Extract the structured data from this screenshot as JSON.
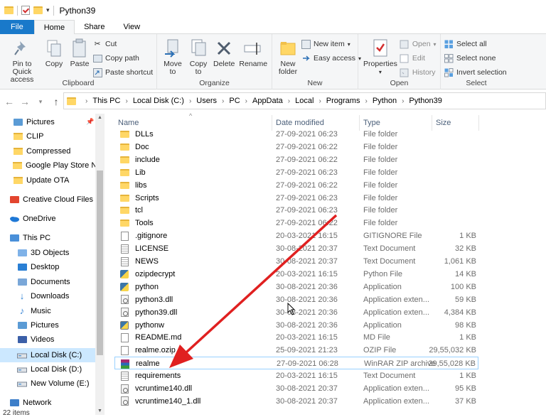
{
  "title": "Python39",
  "tabs": [
    "File",
    "Home",
    "Share",
    "View"
  ],
  "ribbon": {
    "clipboard": {
      "label": "Clipboard",
      "pin": "Pin to Quick access",
      "copy": "Copy",
      "paste": "Paste",
      "cut": "Cut",
      "copy_path": "Copy path",
      "paste_shortcut": "Paste shortcut"
    },
    "organize": {
      "label": "Organize",
      "move_to": "Move to",
      "copy_to": "Copy to",
      "delete": "Delete",
      "rename": "Rename"
    },
    "new": {
      "label": "New",
      "new_folder": "New folder",
      "new_item": "New item",
      "easy_access": "Easy access"
    },
    "open": {
      "label": "Open",
      "properties": "Properties",
      "open": "Open",
      "edit": "Edit",
      "history": "History"
    },
    "select": {
      "label": "Select",
      "select_all": "Select all",
      "select_none": "Select none",
      "invert": "Invert selection"
    }
  },
  "address": {
    "crumbs": [
      "This PC",
      "Local Disk (C:)",
      "Users",
      "PC",
      "AppData",
      "Local",
      "Programs",
      "Python",
      "Python39"
    ]
  },
  "nav": [
    {
      "label": "Pictures",
      "icon": "pictures-icon"
    },
    {
      "label": "CLIP",
      "icon": "folder-icon"
    },
    {
      "label": "Compressed",
      "icon": "folder-icon"
    },
    {
      "label": "Google Play Store N",
      "icon": "folder-icon"
    },
    {
      "label": "Update OTA",
      "icon": "folder-icon"
    },
    {
      "label": "Creative Cloud Files",
      "icon": "creative-cloud-icon"
    },
    {
      "label": "OneDrive",
      "icon": "onedrive-icon"
    },
    {
      "label": "This PC",
      "icon": "this-pc-icon"
    },
    {
      "label": "3D Objects",
      "icon": "3d-objects-icon"
    },
    {
      "label": "Desktop",
      "icon": "desktop-icon"
    },
    {
      "label": "Documents",
      "icon": "documents-icon"
    },
    {
      "label": "Downloads",
      "icon": "downloads-icon"
    },
    {
      "label": "Music",
      "icon": "music-icon"
    },
    {
      "label": "Pictures",
      "icon": "pictures-icon"
    },
    {
      "label": "Videos",
      "icon": "videos-icon"
    },
    {
      "label": "Local Disk (C:)",
      "icon": "drive-icon"
    },
    {
      "label": "Local Disk (D:)",
      "icon": "drive-icon"
    },
    {
      "label": "New Volume (E:)",
      "icon": "drive-icon"
    },
    {
      "label": "Network",
      "icon": "network-icon"
    }
  ],
  "columns": [
    "Name",
    "Date modified",
    "Type",
    "Size"
  ],
  "files": [
    {
      "name": "DLLs",
      "date": "27-09-2021 06:23",
      "type": "File folder",
      "size": "",
      "icon": "folder"
    },
    {
      "name": "Doc",
      "date": "27-09-2021 06:22",
      "type": "File folder",
      "size": "",
      "icon": "folder"
    },
    {
      "name": "include",
      "date": "27-09-2021 06:22",
      "type": "File folder",
      "size": "",
      "icon": "folder"
    },
    {
      "name": "Lib",
      "date": "27-09-2021 06:23",
      "type": "File folder",
      "size": "",
      "icon": "folder"
    },
    {
      "name": "libs",
      "date": "27-09-2021 06:22",
      "type": "File folder",
      "size": "",
      "icon": "folder"
    },
    {
      "name": "Scripts",
      "date": "27-09-2021 06:23",
      "type": "File folder",
      "size": "",
      "icon": "folder"
    },
    {
      "name": "tcl",
      "date": "27-09-2021 06:23",
      "type": "File folder",
      "size": "",
      "icon": "folder"
    },
    {
      "name": "Tools",
      "date": "27-09-2021 06:22",
      "type": "File folder",
      "size": "",
      "icon": "folder"
    },
    {
      "name": ".gitignore",
      "date": "20-03-2021 16:15",
      "type": "GITIGNORE File",
      "size": "1 KB",
      "icon": "doc"
    },
    {
      "name": "LICENSE",
      "date": "30-08-2021 20:37",
      "type": "Text Document",
      "size": "32 KB",
      "icon": "txt"
    },
    {
      "name": "NEWS",
      "date": "30-08-2021 20:37",
      "type": "Text Document",
      "size": "1,061 KB",
      "icon": "txt"
    },
    {
      "name": "ozipdecrypt",
      "date": "20-03-2021 16:15",
      "type": "Python File",
      "size": "14 KB",
      "icon": "py"
    },
    {
      "name": "python",
      "date": "30-08-2021 20:36",
      "type": "Application",
      "size": "100 KB",
      "icon": "py"
    },
    {
      "name": "python3.dll",
      "date": "30-08-2021 20:36",
      "type": "Application exten...",
      "size": "59 KB",
      "icon": "dll"
    },
    {
      "name": "python39.dll",
      "date": "30-08-2021 20:36",
      "type": "Application exten...",
      "size": "4,384 KB",
      "icon": "dll"
    },
    {
      "name": "pythonw",
      "date": "30-08-2021 20:36",
      "type": "Application",
      "size": "98 KB",
      "icon": "pyw"
    },
    {
      "name": "README.md",
      "date": "20-03-2021 16:15",
      "type": "MD File",
      "size": "1 KB",
      "icon": "doc"
    },
    {
      "name": "realme.ozip",
      "date": "25-09-2021 21:23",
      "type": "OZIP File",
      "size": "29,55,032 KB",
      "icon": "doc"
    },
    {
      "name": "realme",
      "date": "27-09-2021 06:28",
      "type": "WinRAR ZIP archive",
      "size": "29,55,028 KB",
      "icon": "rar"
    },
    {
      "name": "requirements",
      "date": "20-03-2021 16:15",
      "type": "Text Document",
      "size": "1 KB",
      "icon": "txt"
    },
    {
      "name": "vcruntime140.dll",
      "date": "30-08-2021 20:37",
      "type": "Application exten...",
      "size": "95 KB",
      "icon": "dll"
    },
    {
      "name": "vcruntime140_1.dll",
      "date": "30-08-2021 20:37",
      "type": "Application exten...",
      "size": "37 KB",
      "icon": "dll"
    }
  ],
  "status": "22 items",
  "colors": {
    "file_tab": "#1979ca",
    "selection": "#cce8ff",
    "annotation_arrow": "#e02020"
  }
}
